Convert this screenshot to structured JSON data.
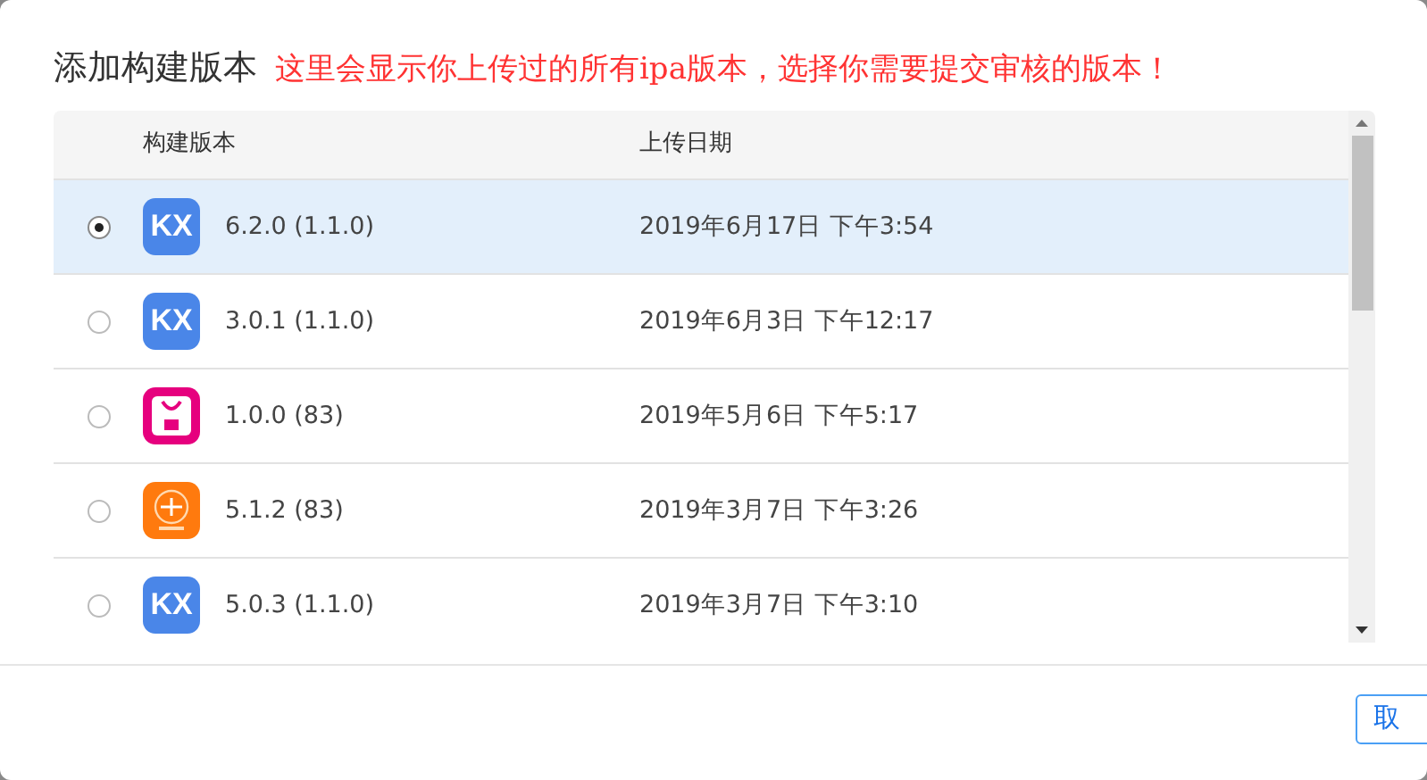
{
  "dialog": {
    "title": "添加构建版本",
    "note": "这里会显示你上传过的所有ipa版本，选择你需要提交审核的版本！"
  },
  "table": {
    "columns": [
      "构建版本",
      "上传日期"
    ],
    "rows": [
      {
        "selected": true,
        "icon": {
          "kind": "kx",
          "text": "KX"
        },
        "version": "6.2.0 (1.1.0)",
        "date": "2019年6月17日 下午3:54"
      },
      {
        "selected": false,
        "icon": {
          "kind": "kx",
          "text": "KX"
        },
        "version": "3.0.1 (1.1.0)",
        "date": "2019年6月3日 下午12:17"
      },
      {
        "selected": false,
        "icon": {
          "kind": "bag"
        },
        "version": "1.0.0 (83)",
        "date": "2019年5月6日 下午5:17"
      },
      {
        "selected": false,
        "icon": {
          "kind": "emblem"
        },
        "version": "5.1.2 (83)",
        "date": "2019年3月7日 下午3:26"
      },
      {
        "selected": false,
        "icon": {
          "kind": "kx",
          "text": "KX"
        },
        "version": "5.0.3 (1.1.0)",
        "date": "2019年3月7日 下午3:10"
      }
    ]
  },
  "buttons": [
    "取"
  ]
}
